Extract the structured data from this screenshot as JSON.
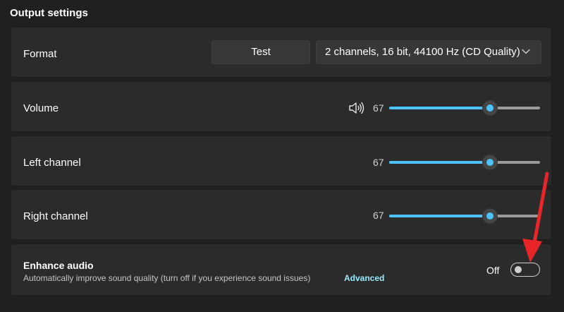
{
  "section": {
    "title": "Output settings"
  },
  "format": {
    "label": "Format",
    "test_label": "Test",
    "selected_format": "2 channels, 16 bit, 44100 Hz (CD Quality)"
  },
  "volume": {
    "label": "Volume",
    "value": 67,
    "value_text": "67",
    "icon": "speaker-icon"
  },
  "left_channel": {
    "label": "Left channel",
    "value": 67,
    "value_text": "67"
  },
  "right_channel": {
    "label": "Right channel",
    "value": 67,
    "value_text": "67"
  },
  "enhance_audio": {
    "title": "Enhance audio",
    "description": "Automatically improve sound quality (turn off if you experience sound issues)",
    "advanced_label": "Advanced",
    "toggle_state_label": "Off",
    "enabled": false
  },
  "colors": {
    "accent": "#4cc2ff",
    "link": "#99ebff",
    "annotation_arrow": "#e8262a",
    "card_background": "#2b2b2b",
    "page_background": "#202020"
  }
}
